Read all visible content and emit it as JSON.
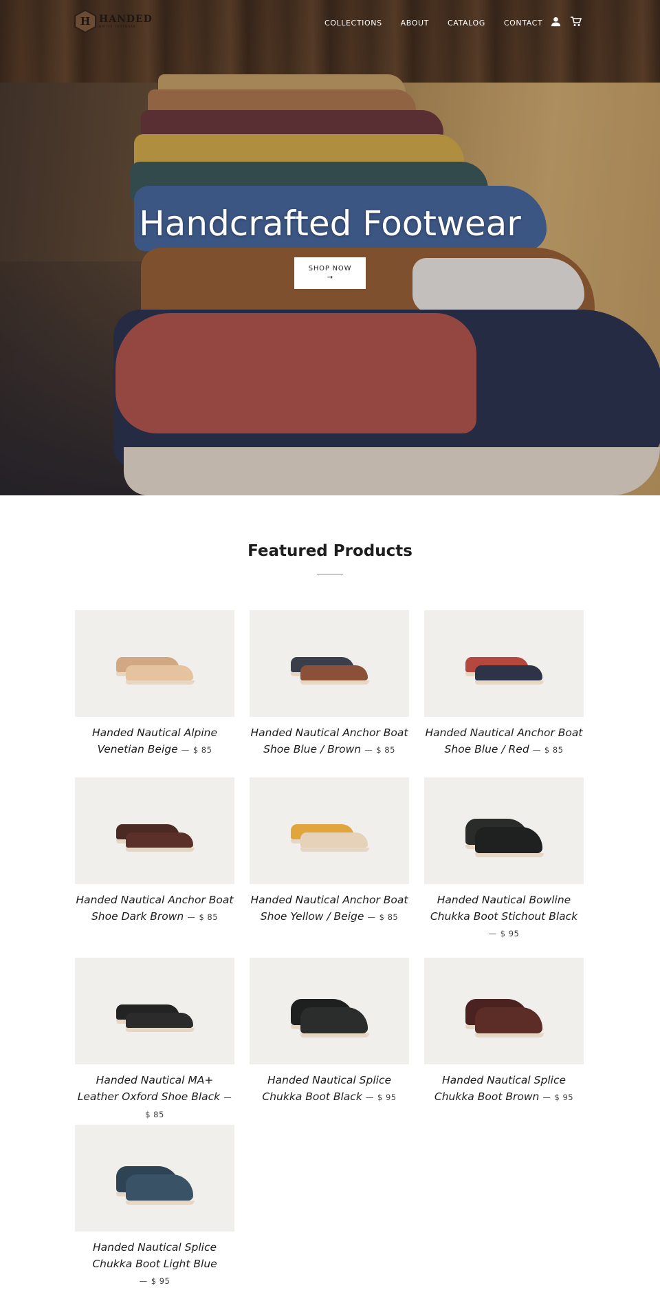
{
  "nav": {
    "logo_mark": "H",
    "logo_word": "HANDED",
    "logo_sub": "NATIVE FOOTWEAR",
    "links": [
      "COLLECTIONS",
      "ABOUT",
      "CATALOG",
      "CONTACT"
    ],
    "icons": [
      "account-icon",
      "cart-icon"
    ]
  },
  "hero": {
    "title": "Handcrafted Footwear",
    "button_label": "SHOP NOW",
    "button_arrow": "→"
  },
  "featured": {
    "title": "Featured Products",
    "products": [
      {
        "name": "Handed Nautical Alpine Venetian Beige",
        "price": "$ 85",
        "colors": [
          "#d1a883",
          "#e6c39f"
        ]
      },
      {
        "name": "Handed Nautical Anchor Boat Shoe Blue / Brown",
        "price": "$ 85",
        "colors": [
          "#3a3d4a",
          "#8a5038"
        ]
      },
      {
        "name": "Handed Nautical Anchor Boat Shoe Blue / Red",
        "price": "$ 85",
        "colors": [
          "#b4473e",
          "#2e3447"
        ]
      },
      {
        "name": "Handed Nautical Anchor Boat Shoe Dark Brown",
        "price": "$ 85",
        "colors": [
          "#4a2a22",
          "#5a3028"
        ]
      },
      {
        "name": "Handed Nautical Anchor Boat Shoe Yellow / Beige",
        "price": "$ 85",
        "colors": [
          "#e0a63c",
          "#e6d2b8"
        ]
      },
      {
        "name": "Handed Nautical Bowline Chukka Boot Stichout Black",
        "price": "$ 95",
        "colors": [
          "#2a2c2a",
          "#1f2120"
        ]
      },
      {
        "name": "Handed Nautical MA+ Leather Oxford Shoe Black",
        "price": "$ 85",
        "colors": [
          "#222322",
          "#2a2b2a"
        ]
      },
      {
        "name": "Handed Nautical Splice Chukka Boot Black",
        "price": "$ 95",
        "colors": [
          "#1e1f1f",
          "#2b2c2c"
        ]
      },
      {
        "name": "Handed Nautical Splice Chukka Boot Brown",
        "price": "$ 95",
        "colors": [
          "#4a2320",
          "#5c2c26"
        ]
      },
      {
        "name": "Handed Nautical Splice Chukka Boot Light Blue",
        "price": "$ 95",
        "colors": [
          "#2e4354",
          "#3a5266"
        ]
      }
    ]
  }
}
